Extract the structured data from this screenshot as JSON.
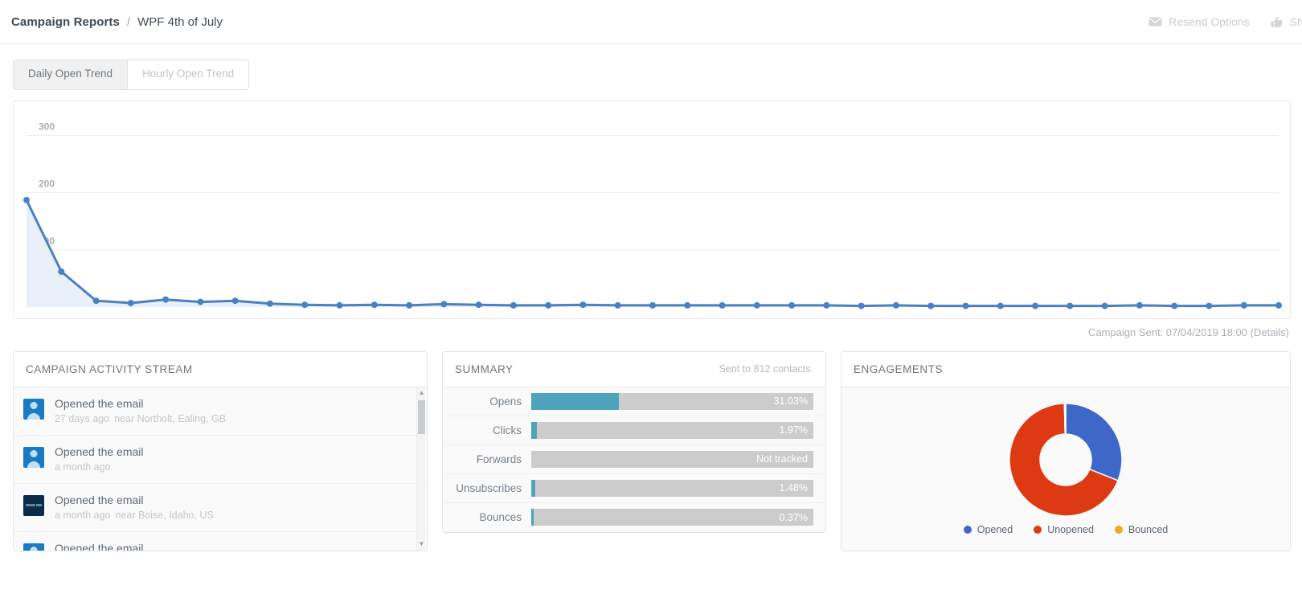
{
  "header": {
    "breadcrumb_root": "Campaign Reports",
    "breadcrumb_separator": "/",
    "breadcrumb_leaf": "WPF 4th of July",
    "actions": [
      {
        "label": "Resend Options",
        "icon": "envelope-icon"
      },
      {
        "label": "Share",
        "icon": "thumbs-up-icon"
      }
    ]
  },
  "tabs": [
    {
      "label": "Daily Open Trend",
      "active": true
    },
    {
      "label": "Hourly Open Trend",
      "active": false
    }
  ],
  "chart_note": "Campaign Sent: 07/04/2019 18:00 (Details)",
  "chart_data": {
    "type": "line",
    "title": "Daily Open Trend",
    "xlabel": "",
    "ylabel": "",
    "ylim": [
      0,
      340
    ],
    "yticks": [
      100,
      200,
      300
    ],
    "grid": true,
    "legend": "none",
    "area_fill": true,
    "line_color": "#4a80c4",
    "x": [
      1,
      2,
      3,
      4,
      5,
      6,
      7,
      8,
      9,
      10,
      11,
      12,
      13,
      14,
      15,
      16,
      17,
      18,
      19,
      20,
      21,
      22,
      23,
      24,
      25,
      26,
      27,
      28,
      29,
      30,
      31,
      32,
      33,
      34,
      35,
      36,
      37
    ],
    "values": [
      187,
      62,
      11,
      7,
      13,
      9,
      11,
      6,
      4,
      3,
      4,
      3,
      5,
      4,
      3,
      3,
      4,
      3,
      3,
      3,
      3,
      3,
      3,
      3,
      2,
      3,
      2,
      2,
      2,
      2,
      2,
      2,
      3,
      2,
      2,
      3,
      3
    ]
  },
  "activity": {
    "title": "CAMPAIGN ACTIVITY STREAM",
    "rows": [
      {
        "avatar": "generic",
        "title": "Opened the email",
        "time": "27 days ago",
        "location": "near Northolt, Ealing, GB"
      },
      {
        "avatar": "generic",
        "title": "Opened the email",
        "time": "a month ago",
        "location": ""
      },
      {
        "avatar": "logo",
        "title": "Opened the email",
        "time": "a month ago",
        "location": "near Boise, Idaho, US"
      },
      {
        "avatar": "generic",
        "title": "Opened the email",
        "time": "",
        "location": ""
      }
    ]
  },
  "summary": {
    "title": "SUMMARY",
    "sent_to": "Sent to 812 contacts.",
    "bar_color": "#4fa3bd",
    "track_color": "#cccccc",
    "rows": [
      {
        "label": "Opens",
        "value": "31.03%",
        "percent": 31.03
      },
      {
        "label": "Clicks",
        "value": "1.97%",
        "percent": 1.97
      },
      {
        "label": "Forwards",
        "value": "Not tracked",
        "percent": 0
      },
      {
        "label": "Unsubscribes",
        "value": "1.48%",
        "percent": 1.48
      },
      {
        "label": "Bounces",
        "value": "0.37%",
        "percent": 0.37
      }
    ]
  },
  "engagements": {
    "title": "ENGAGEMENTS",
    "chart_data": {
      "type": "pie",
      "title": "ENGAGEMENTS",
      "categories": [
        "Opened",
        "Unopened",
        "Bounced"
      ],
      "values": [
        31.03,
        68.6,
        0.37
      ],
      "colors": [
        "#3d68c9",
        "#dd3a14",
        "#f5a623"
      ],
      "legend": "bottom",
      "donut": true
    },
    "legend": [
      {
        "label": "Opened",
        "color": "#3d68c9"
      },
      {
        "label": "Unopened",
        "color": "#dd3a14"
      },
      {
        "label": "Bounced",
        "color": "#f5a623"
      }
    ]
  }
}
